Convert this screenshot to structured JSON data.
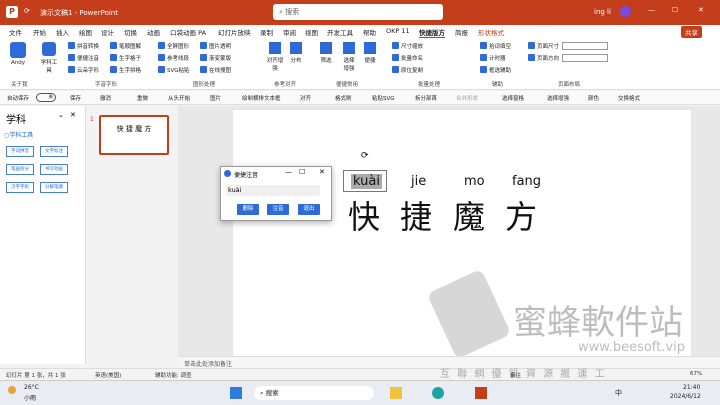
{
  "window": {
    "doc_title": "演示文稿1 - PowerPoint",
    "search_placeholder": "搜索",
    "user": "ing li",
    "share_label": "共享"
  },
  "menu": [
    "文件",
    "开始",
    "插入",
    "绘图",
    "设计",
    "切换",
    "动画",
    "口袋动画 PA",
    "幻灯片放映",
    "录制",
    "审阅",
    "视图",
    "开发工具",
    "帮助",
    "OKP 11",
    "快捷版方",
    "简报",
    "形状格式"
  ],
  "ribbon": {
    "andy": "Andy",
    "xueke": "学科工具",
    "row1": [
      "拼音转换",
      "笔顺图解",
      "全屏图形",
      "图片透明",
      "对齐增强",
      "分布",
      "筛选",
      "选择增强",
      "便捷",
      "尺寸缩放",
      "批量命名",
      "原位复制",
      "拾词填空",
      "计时器",
      "框选辅助",
      "页面尺寸",
      "页面方向"
    ],
    "col2": [
      "便捷注音",
      "云朵字形",
      "生字格子",
      "生字拼格",
      "参考线段",
      "渐变蒙版",
      "SVG粘贴",
      "在线搜图"
    ],
    "groups": [
      "关于我",
      "字音字形",
      "图形处理",
      "参考对齐",
      "便捷常用",
      "批量处理",
      "辅助",
      "页面布局"
    ]
  },
  "quickbar": [
    "自动保存",
    "关",
    "保存",
    "撤消",
    "重做",
    "从头开始",
    "图片",
    "绘制横排文本框",
    "对齐",
    "格式刷",
    "粘贴SVG",
    "拆分部首",
    "合并形状",
    "选择窗格",
    "选择增强",
    "颜色",
    "交换格式"
  ],
  "leftpanel": {
    "title": "学科",
    "subtitle": "○学科工具",
    "buttons": [
      "字词拼音",
      "文字标注",
      "笔画拆分",
      "书写动画",
      "汉字字形",
      "分解笔顺"
    ]
  },
  "slide": {
    "number": "1",
    "thumb_text": "快 捷 魔 方",
    "pinyin": [
      "kuài",
      "jie",
      "mo",
      "fang"
    ],
    "hanzi": [
      "快",
      "捷",
      "魔",
      "方"
    ]
  },
  "dialog": {
    "title": "便捷注音",
    "value": "kuài",
    "buttons": [
      "删除",
      "注音",
      "退出"
    ]
  },
  "notes_placeholder": "单击此处添加备注",
  "status": {
    "slide_info": "幻灯片 第 1 张，共 1 张",
    "lang": "英语(美国)",
    "accessibility": "辅助功能: 调查",
    "notes": "备注",
    "zoom": "67%"
  },
  "watermark": {
    "brand": "蜜蜂軟件站",
    "url": "www.beesoft.vip",
    "tagline": "互 聯 網 優 質 資 源 搬 運 工"
  },
  "taskbar": {
    "weather": "26°C",
    "weather_desc": "小雨",
    "search": "搜索",
    "time": "21:40",
    "date": "2024/6/12",
    "lang": "中"
  },
  "colors": {
    "brand": "#c43e1c",
    "accent": "#2e6bd6"
  }
}
